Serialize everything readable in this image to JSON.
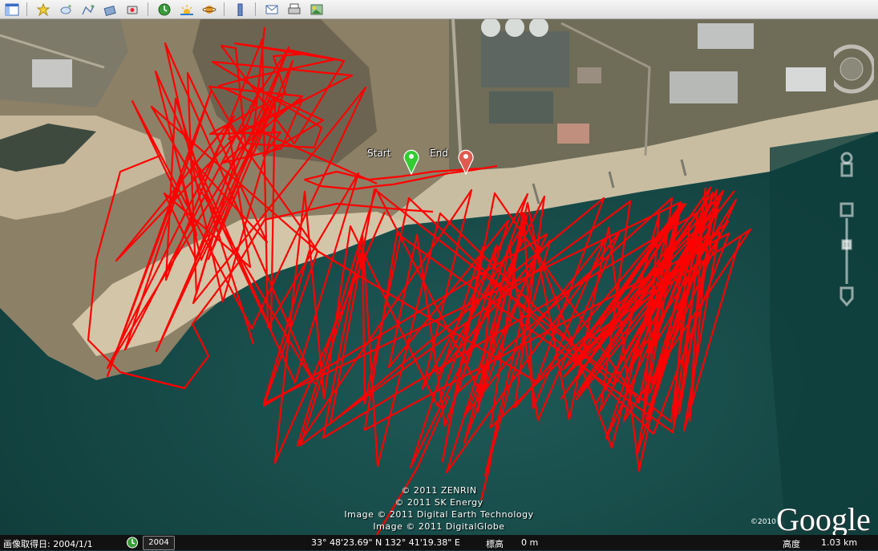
{
  "toolbar": {
    "buttons": [
      {
        "name": "sidebar-toggle-icon"
      },
      {
        "name": "add-placemark-icon"
      },
      {
        "name": "add-polygon-icon"
      },
      {
        "name": "add-path-icon"
      },
      {
        "name": "add-image-overlay-icon"
      },
      {
        "name": "record-tour-icon"
      },
      {
        "name": "historical-imagery-icon"
      },
      {
        "name": "sunlight-icon"
      },
      {
        "name": "planets-icon"
      },
      {
        "name": "ruler-icon"
      },
      {
        "name": "email-icon"
      },
      {
        "name": "print-icon"
      },
      {
        "name": "save-image-icon"
      }
    ]
  },
  "map": {
    "track_color": "#ff0000",
    "markers": {
      "start_label": "Start",
      "end_label": "End",
      "start_color": "#33cc33",
      "end_color": "#e05a4f"
    },
    "copyright": [
      "© 2011 ZENRIN",
      "© 2011 SK Energy",
      "Image © 2011 Digital Earth Technology",
      "Image © 2011 DigitalGlobe"
    ],
    "logo_year": "©2010",
    "logo_text": "Google",
    "compass_letter": "N"
  },
  "status": {
    "imagery_date": "画像取得日: 2004/1/1",
    "year_chip": "2004",
    "coords": "33° 48'23.69\" N 132° 41'19.38\" E",
    "elev_label": "標高",
    "elev_value": "0 m",
    "altitude_label": "高度",
    "altitude_value": "1.03 km"
  }
}
